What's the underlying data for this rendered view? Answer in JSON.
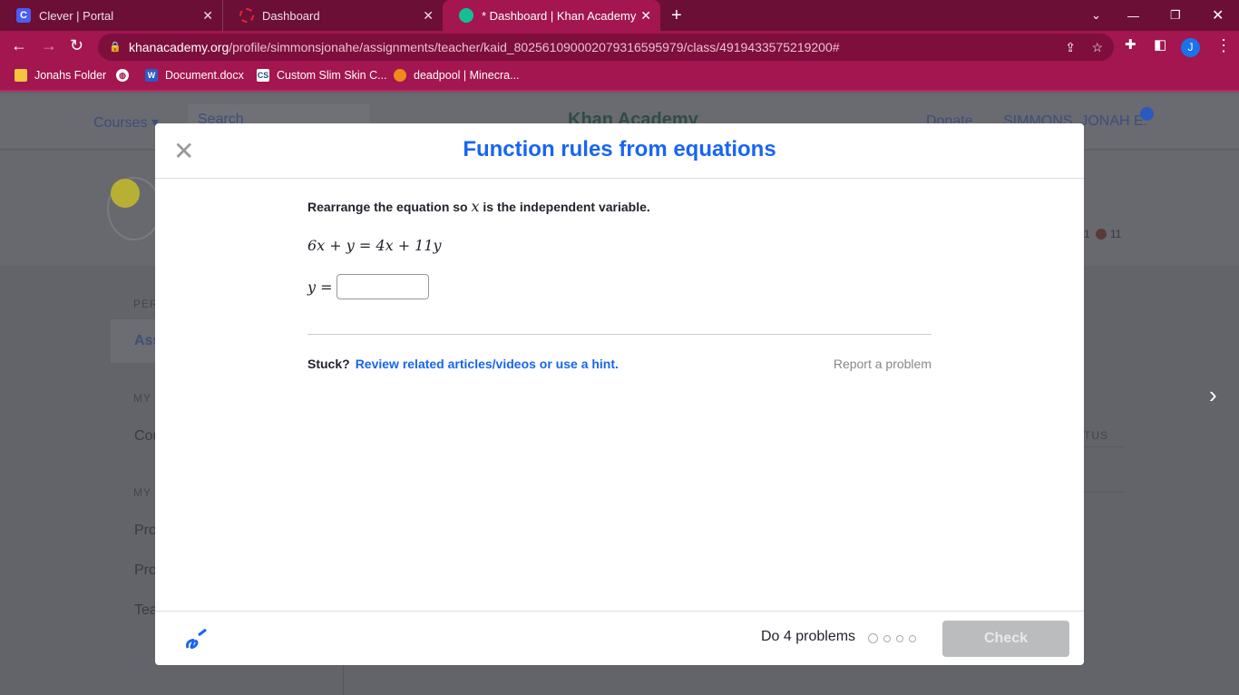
{
  "browser": {
    "tabs": [
      {
        "title": "Clever | Portal",
        "icon": "clever-icon"
      },
      {
        "title": "Dashboard",
        "icon": "dashboard-icon"
      },
      {
        "title": "* Dashboard | Khan Academy",
        "icon": "khan-icon",
        "active": true
      }
    ],
    "url_domain": "khanacademy.org",
    "url_path": "/profile/simmonsjonahe/assignments/teacher/kaid_802561090002079316595979/class/4919433575219200#",
    "profile_initial": "J",
    "bookmarks": [
      "Jonahs Folder",
      "Document.docx",
      "Custom Slim Skin C...",
      "deadpool | Minecra..."
    ]
  },
  "background": {
    "courses": "Courses ▾",
    "search": "Search",
    "logo": "Khan Academy",
    "donate": "Donate",
    "user": "SIMMONS, JONAH E.",
    "sidebar": [
      "PER",
      "Ass",
      "MY",
      "Cou",
      "MY",
      "Pro",
      "Pro",
      "Tea"
    ],
    "stats": "1",
    "stat2": "11",
    "status": "TUS"
  },
  "modal": {
    "title": "Function rules from equations",
    "prompt_pre": "Rearrange the equation so ",
    "prompt_var": "x",
    "prompt_post": " is the independent variable.",
    "equation": "6x + y = 4x + 11y",
    "answer_label": "y =",
    "answer_value": "",
    "stuck": "Stuck?",
    "hint_link": "Review related articles/videos or use a hint.",
    "report": "Report a problem",
    "do_problems": "Do 4 problems",
    "progress_completed": 0,
    "progress_total": 4,
    "check": "Check"
  },
  "colors": {
    "accent": "#1865f2",
    "chrome": "#a3164f"
  }
}
